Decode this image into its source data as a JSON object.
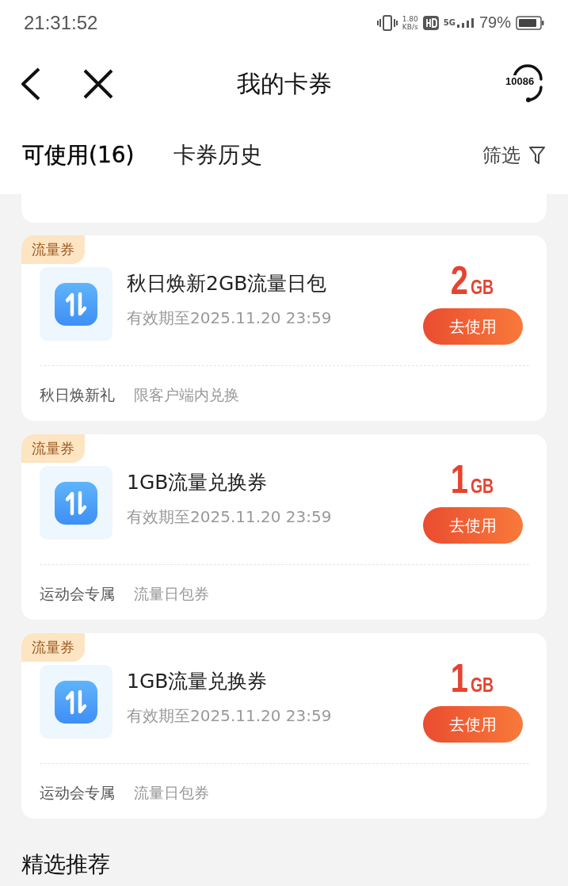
{
  "status_bar": {
    "time": "21:31:52",
    "speed_value": "1.80",
    "speed_unit": "KB/s",
    "network": "5G",
    "battery": "79%"
  },
  "header": {
    "title": "我的卡券",
    "service_number": "10086"
  },
  "tabs": [
    {
      "label": "可使用(16)",
      "selected": true
    },
    {
      "label": "卡券历史",
      "selected": false
    }
  ],
  "filter": {
    "label": "筛选"
  },
  "coupons": [
    {
      "tag": "流量券",
      "title": "秋日焕新2GB流量日包",
      "validity": "有效期至2025.11.20 23:59",
      "amount": "2",
      "unit": "GB",
      "action": "去使用",
      "notes": [
        "秋日焕新礼",
        "限客户端内兑换"
      ]
    },
    {
      "tag": "流量券",
      "title": "1GB流量兑换券",
      "validity": "有效期至2025.11.20 23:59",
      "amount": "1",
      "unit": "GB",
      "action": "去使用",
      "notes": [
        "运动会专属",
        "流量日包券"
      ]
    },
    {
      "tag": "流量券",
      "title": "1GB流量兑换券",
      "validity": "有效期至2025.11.20 23:59",
      "amount": "1",
      "unit": "GB",
      "action": "去使用",
      "notes": [
        "运动会专属",
        "流量日包券"
      ]
    }
  ],
  "recommend": {
    "title": "精选推荐"
  }
}
